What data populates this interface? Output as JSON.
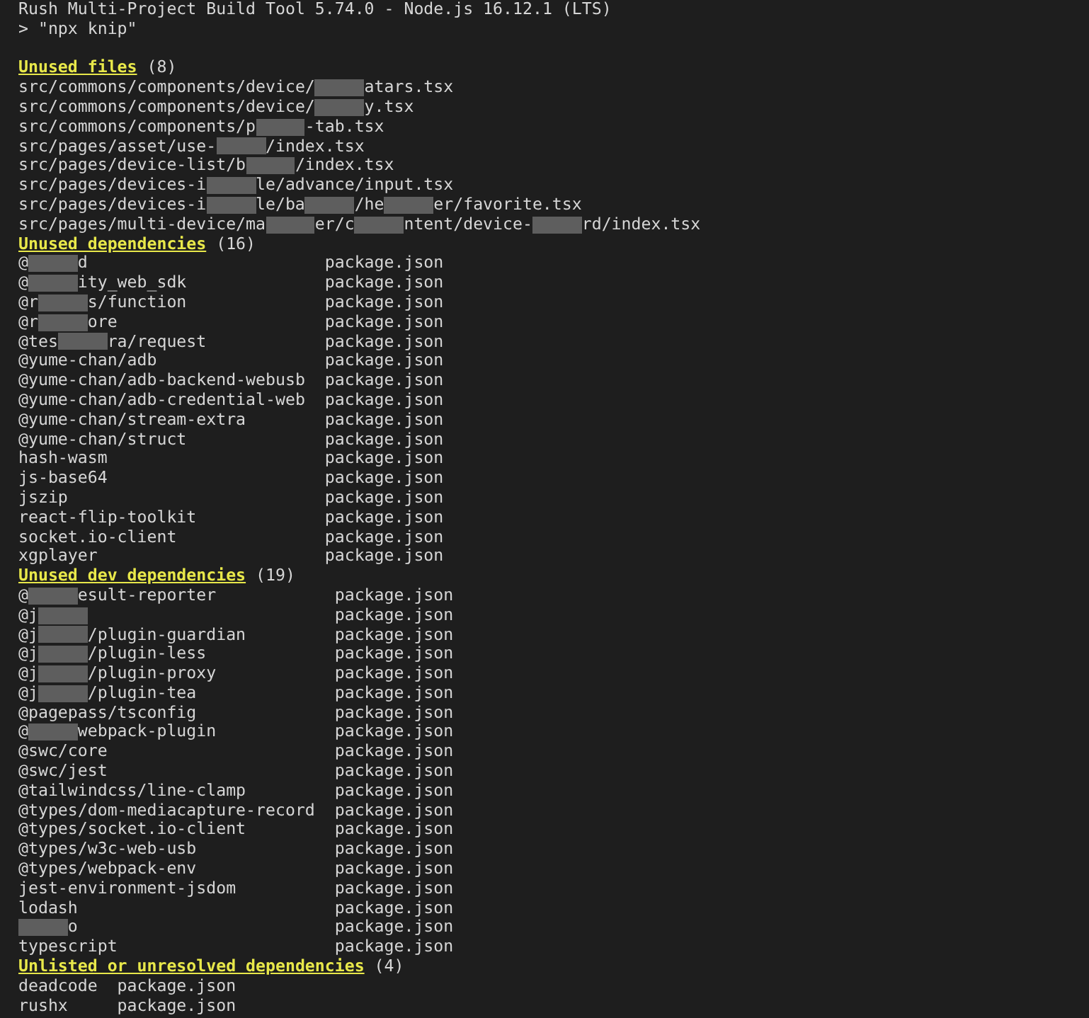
{
  "header_lines": [
    "Rush Multi-Project Build Tool 5.74.0 - Node.js 16.12.1 (LTS)",
    "> \"npx knip\""
  ],
  "sections": [
    {
      "kind": "files",
      "title": "Unused files",
      "count": "(8)",
      "items": [
        {
          "parts": [
            {
              "kind": "text",
              "text": "src/commons/components/device/"
            },
            {
              "kind": "redacted"
            },
            {
              "kind": "text",
              "text": "atars.tsx"
            }
          ]
        },
        {
          "parts": [
            {
              "kind": "text",
              "text": "src/commons/components/device/"
            },
            {
              "kind": "redacted"
            },
            {
              "kind": "text",
              "text": "y.tsx"
            }
          ]
        },
        {
          "parts": [
            {
              "kind": "text",
              "text": "src/commons/components/p"
            },
            {
              "kind": "redacted"
            },
            {
              "kind": "text",
              "text": "-tab.tsx"
            }
          ]
        },
        {
          "parts": [
            {
              "kind": "text",
              "text": "src/pages/asset/use-"
            },
            {
              "kind": "redacted"
            },
            {
              "kind": "text",
              "text": "/index.tsx"
            }
          ]
        },
        {
          "parts": [
            {
              "kind": "text",
              "text": "src/pages/device-list/b"
            },
            {
              "kind": "redacted"
            },
            {
              "kind": "text",
              "text": "/index.tsx"
            }
          ]
        },
        {
          "parts": [
            {
              "kind": "text",
              "text": "src/pages/devices-i"
            },
            {
              "kind": "redacted"
            },
            {
              "kind": "text",
              "text": "le/advance/input.tsx"
            }
          ]
        },
        {
          "parts": [
            {
              "kind": "text",
              "text": "src/pages/devices-i"
            },
            {
              "kind": "redacted"
            },
            {
              "kind": "text",
              "text": "le/ba"
            },
            {
              "kind": "redacted"
            },
            {
              "kind": "text",
              "text": "/he"
            },
            {
              "kind": "redacted"
            },
            {
              "kind": "text",
              "text": "er/favorite.tsx"
            }
          ]
        },
        {
          "parts": [
            {
              "kind": "text",
              "text": "src/pages/multi-device/ma"
            },
            {
              "kind": "redacted"
            },
            {
              "kind": "text",
              "text": "er/c"
            },
            {
              "kind": "redacted"
            },
            {
              "kind": "text",
              "text": "ntent/device-"
            },
            {
              "kind": "redacted"
            },
            {
              "kind": "text",
              "text": "rd/index.tsx"
            }
          ]
        }
      ]
    },
    {
      "kind": "dependencies",
      "title": "Unused dependencies",
      "count": "(16)",
      "items": [
        {
          "parts": [
            {
              "kind": "text",
              "text": "@"
            },
            {
              "kind": "redacted"
            },
            {
              "kind": "text",
              "text": "d"
            }
          ],
          "location": "package.json"
        },
        {
          "parts": [
            {
              "kind": "text",
              "text": "@"
            },
            {
              "kind": "redacted"
            },
            {
              "kind": "text",
              "text": "ity_web_sdk"
            }
          ],
          "location": "package.json"
        },
        {
          "parts": [
            {
              "kind": "text",
              "text": "@r"
            },
            {
              "kind": "redacted"
            },
            {
              "kind": "text",
              "text": "s/function"
            }
          ],
          "location": "package.json"
        },
        {
          "parts": [
            {
              "kind": "text",
              "text": "@r"
            },
            {
              "kind": "redacted"
            },
            {
              "kind": "text",
              "text": "ore"
            }
          ],
          "location": "package.json"
        },
        {
          "parts": [
            {
              "kind": "text",
              "text": "@tes"
            },
            {
              "kind": "redacted"
            },
            {
              "kind": "text",
              "text": "ra/request"
            }
          ],
          "location": "package.json"
        },
        {
          "parts": [
            {
              "kind": "text",
              "text": "@yume-chan/adb"
            }
          ],
          "location": "package.json"
        },
        {
          "parts": [
            {
              "kind": "text",
              "text": "@yume-chan/adb-backend-webusb"
            }
          ],
          "location": "package.json"
        },
        {
          "parts": [
            {
              "kind": "text",
              "text": "@yume-chan/adb-credential-web"
            }
          ],
          "location": "package.json"
        },
        {
          "parts": [
            {
              "kind": "text",
              "text": "@yume-chan/stream-extra"
            }
          ],
          "location": "package.json"
        },
        {
          "parts": [
            {
              "kind": "text",
              "text": "@yume-chan/struct"
            }
          ],
          "location": "package.json"
        },
        {
          "parts": [
            {
              "kind": "text",
              "text": "hash-wasm"
            }
          ],
          "location": "package.json"
        },
        {
          "parts": [
            {
              "kind": "text",
              "text": "js-base64"
            }
          ],
          "location": "package.json"
        },
        {
          "parts": [
            {
              "kind": "text",
              "text": "jszip"
            }
          ],
          "location": "package.json"
        },
        {
          "parts": [
            {
              "kind": "text",
              "text": "react-flip-toolkit"
            }
          ],
          "location": "package.json"
        },
        {
          "parts": [
            {
              "kind": "text",
              "text": "socket.io-client"
            }
          ],
          "location": "package.json"
        },
        {
          "parts": [
            {
              "kind": "text",
              "text": "xgplayer"
            }
          ],
          "location": "package.json"
        }
      ]
    },
    {
      "kind": "dependencies",
      "title": "Unused dev dependencies",
      "count": "(19)",
      "items": [
        {
          "parts": [
            {
              "kind": "text",
              "text": "@"
            },
            {
              "kind": "redacted"
            },
            {
              "kind": "text",
              "text": "esult-reporter"
            }
          ],
          "location": "package.json"
        },
        {
          "parts": [
            {
              "kind": "text",
              "text": "@j"
            },
            {
              "kind": "redacted"
            }
          ],
          "location": "package.json"
        },
        {
          "parts": [
            {
              "kind": "text",
              "text": "@j"
            },
            {
              "kind": "redacted"
            },
            {
              "kind": "text",
              "text": "/plugin-guardian"
            }
          ],
          "location": "package.json"
        },
        {
          "parts": [
            {
              "kind": "text",
              "text": "@j"
            },
            {
              "kind": "redacted"
            },
            {
              "kind": "text",
              "text": "/plugin-less"
            }
          ],
          "location": "package.json"
        },
        {
          "parts": [
            {
              "kind": "text",
              "text": "@j"
            },
            {
              "kind": "redacted"
            },
            {
              "kind": "text",
              "text": "/plugin-proxy"
            }
          ],
          "location": "package.json"
        },
        {
          "parts": [
            {
              "kind": "text",
              "text": "@j"
            },
            {
              "kind": "redacted"
            },
            {
              "kind": "text",
              "text": "/plugin-tea"
            }
          ],
          "location": "package.json"
        },
        {
          "parts": [
            {
              "kind": "text",
              "text": "@pagepass/tsconfig"
            }
          ],
          "location": "package.json"
        },
        {
          "parts": [
            {
              "kind": "text",
              "text": "@"
            },
            {
              "kind": "redacted"
            },
            {
              "kind": "text",
              "text": "webpack-plugin"
            }
          ],
          "location": "package.json"
        },
        {
          "parts": [
            {
              "kind": "text",
              "text": "@swc/core"
            }
          ],
          "location": "package.json"
        },
        {
          "parts": [
            {
              "kind": "text",
              "text": "@swc/jest"
            }
          ],
          "location": "package.json"
        },
        {
          "parts": [
            {
              "kind": "text",
              "text": "@tailwindcss/line-clamp"
            }
          ],
          "location": "package.json"
        },
        {
          "parts": [
            {
              "kind": "text",
              "text": "@types/dom-mediacapture-record"
            }
          ],
          "location": "package.json"
        },
        {
          "parts": [
            {
              "kind": "text",
              "text": "@types/socket.io-client"
            }
          ],
          "location": "package.json"
        },
        {
          "parts": [
            {
              "kind": "text",
              "text": "@types/w3c-web-usb"
            }
          ],
          "location": "package.json"
        },
        {
          "parts": [
            {
              "kind": "text",
              "text": "@types/webpack-env"
            }
          ],
          "location": "package.json"
        },
        {
          "parts": [
            {
              "kind": "text",
              "text": "jest-environment-jsdom"
            }
          ],
          "location": "package.json"
        },
        {
          "parts": [
            {
              "kind": "text",
              "text": "lodash"
            }
          ],
          "location": "package.json"
        },
        {
          "parts": [
            {
              "kind": "redacted"
            },
            {
              "kind": "text",
              "text": "o"
            }
          ],
          "location": "package.json"
        },
        {
          "parts": [
            {
              "kind": "text",
              "text": "typescript"
            }
          ],
          "location": "package.json"
        }
      ]
    },
    {
      "kind": "dependencies",
      "title": "Unlisted or unresolved dependencies",
      "count": "(4)",
      "items": [
        {
          "parts": [
            {
              "kind": "text",
              "text": "deadcode"
            }
          ],
          "location": "package.json"
        },
        {
          "parts": [
            {
              "kind": "text",
              "text": "rushx"
            }
          ],
          "location": "package.json"
        }
      ]
    }
  ]
}
